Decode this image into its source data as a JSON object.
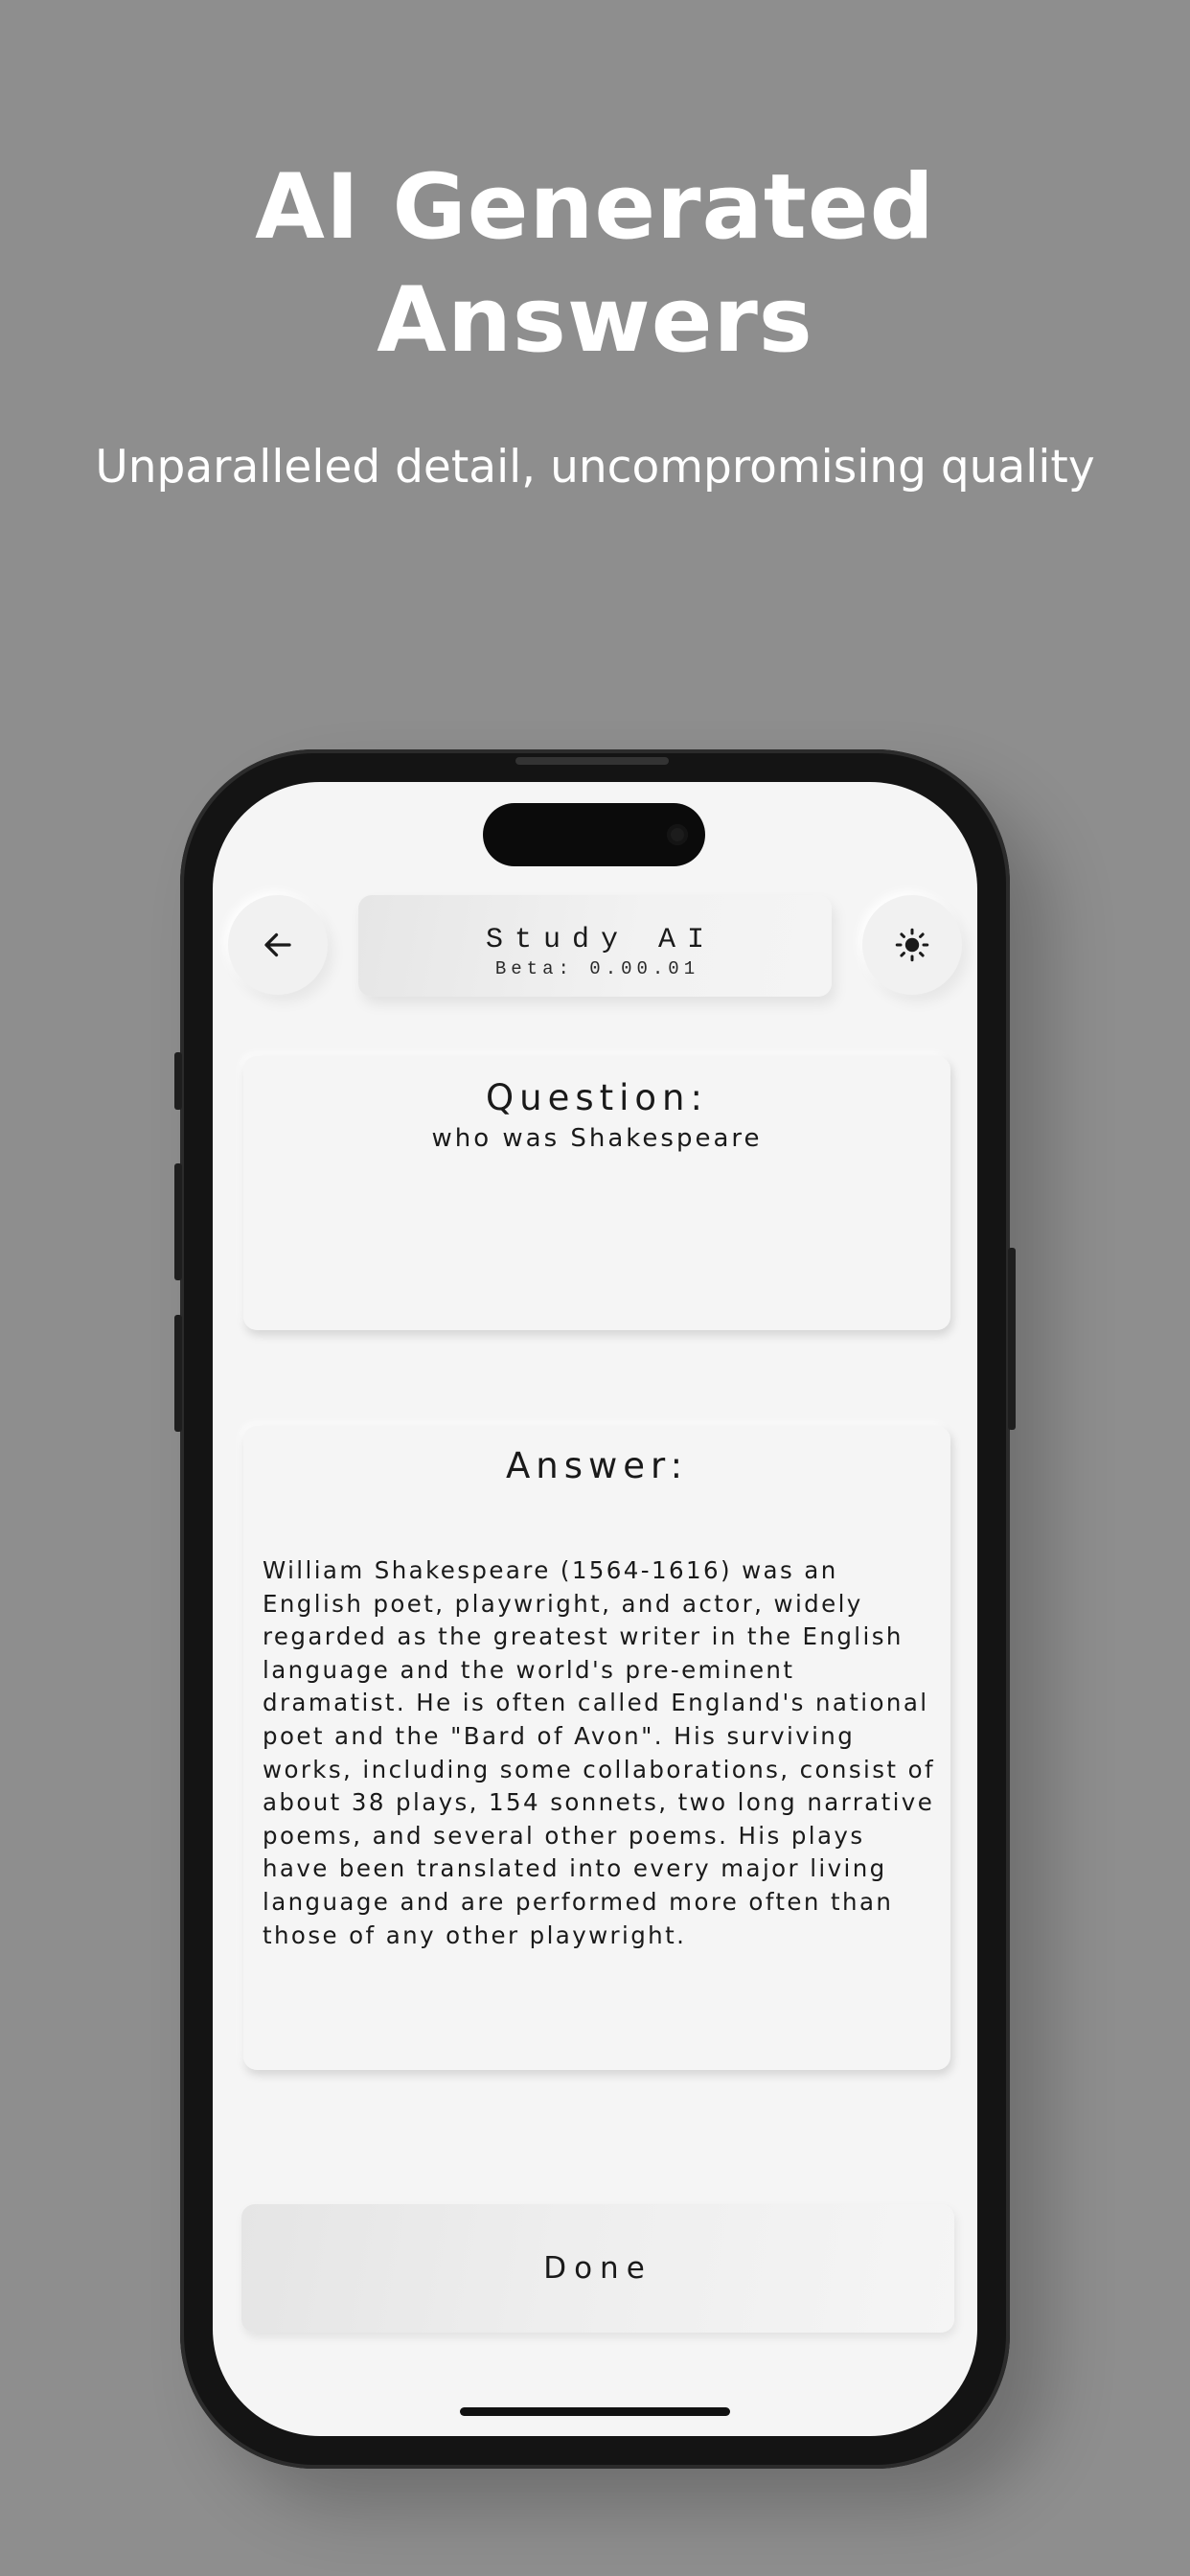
{
  "hero": {
    "title_line1": "AI Generated",
    "title_line2": "Answers",
    "subtitle": "Unparalleled detail, uncompromising quality"
  },
  "header": {
    "app_title": "Study AI",
    "version": "Beta: 0.00.01",
    "back_icon": "arrow-left-icon",
    "theme_icon": "sun-icon"
  },
  "question": {
    "heading": "Question:",
    "text": "who was Shakespeare"
  },
  "answer": {
    "heading": "Answer:",
    "text": "William Shakespeare (1564-1616) was an English poet, playwright, and actor, widely regarded as the greatest writer in the English language and the world's pre-eminent dramatist. He is often called England's national poet and the \"Bard of Avon\". His surviving works, including some collaborations, consist of about 38 plays, 154 sonnets, two long narrative poems, and several other poems. His plays have been translated into every major living language and are performed more often than those of any other playwright."
  },
  "actions": {
    "done_label": "Done"
  },
  "colors": {
    "background": "#8e8e8e",
    "screen": "#f5f5f5",
    "text": "#1a1a1a"
  }
}
